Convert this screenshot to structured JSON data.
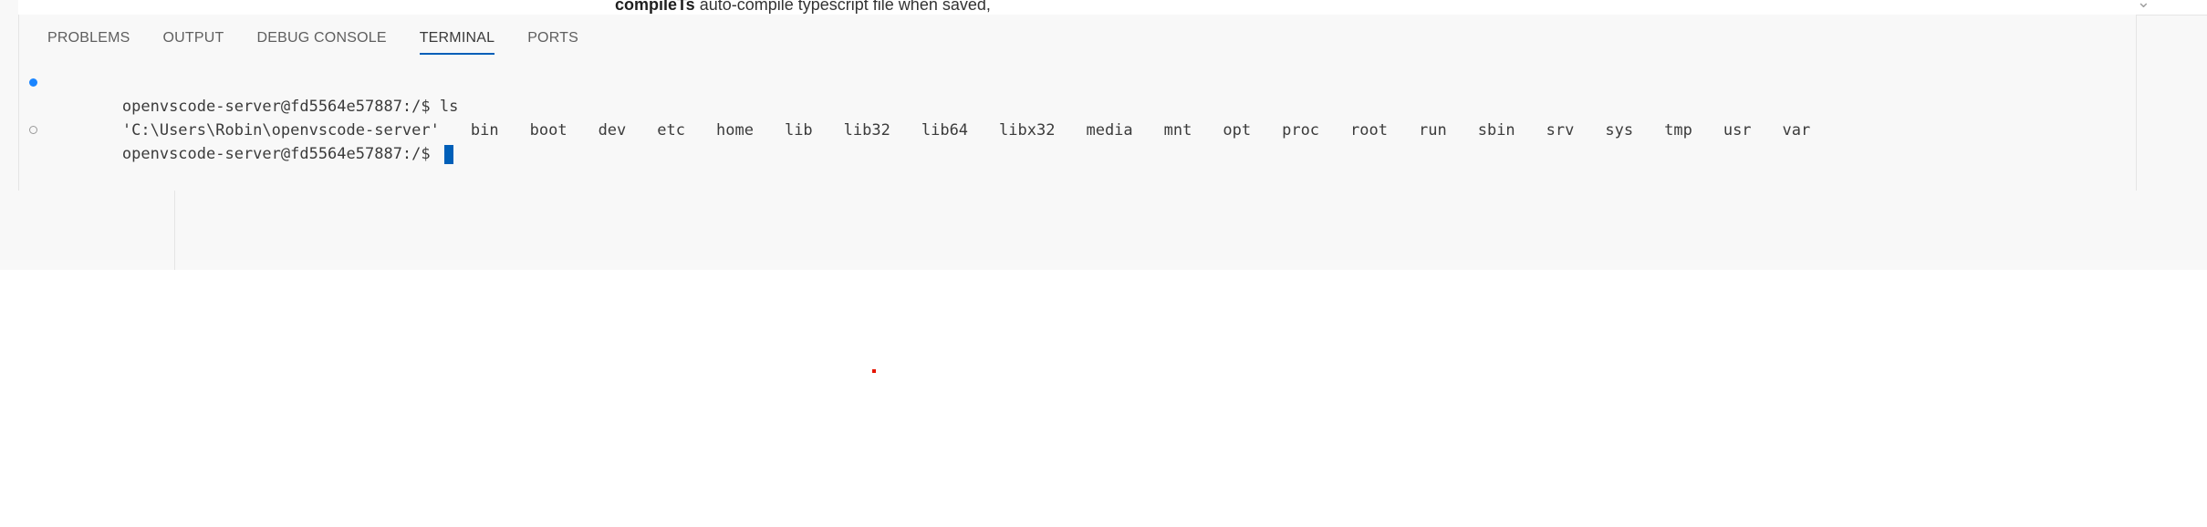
{
  "editor_hint": {
    "keyword": "compileTs",
    "description": "auto-compile typescript file when saved,",
    "chevron_icon": "chevron-down-icon"
  },
  "panel": {
    "tabs": [
      {
        "label": "PROBLEMS",
        "active": false
      },
      {
        "label": "OUTPUT",
        "active": false
      },
      {
        "label": "DEBUG CONSOLE",
        "active": false
      },
      {
        "label": "TERMINAL",
        "active": true
      },
      {
        "label": "PORTS",
        "active": false
      }
    ]
  },
  "terminal": {
    "line1": {
      "prompt": "openvscode-server@fd5564e57887:/$ ",
      "command": "ls",
      "decoration": "success"
    },
    "line2": {
      "entries": [
        "'C:\\Users\\Robin\\openvscode-server'",
        "bin",
        "boot",
        "dev",
        "etc",
        "home",
        "lib",
        "lib32",
        "lib64",
        "libx32",
        "media",
        "mnt",
        "opt",
        "proc",
        "root",
        "run",
        "sbin",
        "srv",
        "sys",
        "tmp",
        "usr",
        "var"
      ]
    },
    "line3": {
      "prompt": "openvscode-server@fd5564e57887:/$ ",
      "decoration": "pending"
    }
  },
  "colors": {
    "accent": "#005fb8",
    "success_decoration": "#1a85ff",
    "marker": "#e51400"
  }
}
